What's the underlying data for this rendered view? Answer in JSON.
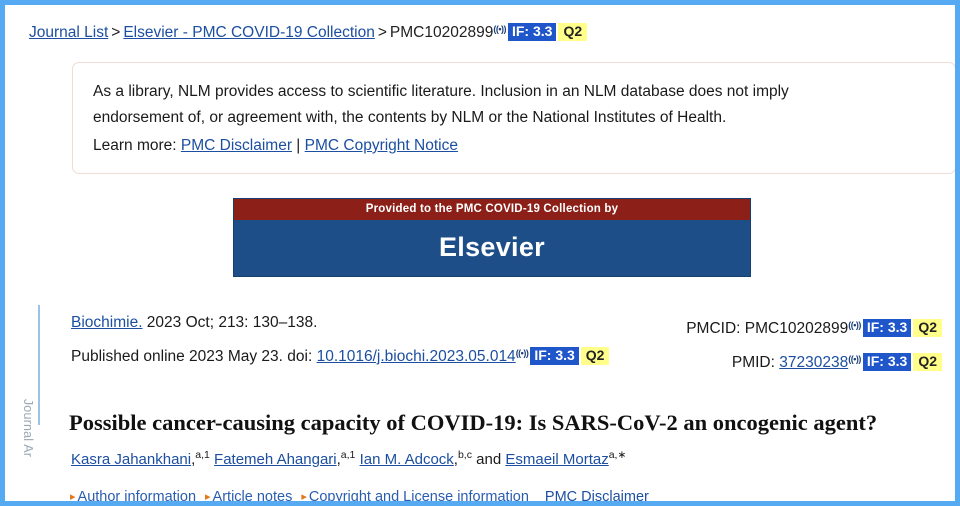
{
  "breadcrumb": {
    "journal_list": "Journal List",
    "separator": ">",
    "collection": "Elsevier - PMC COVID-19 Collection",
    "article_id": "PMC10202899",
    "signal_icon": "((•))",
    "impact_factor_badge": "IF: 3.3",
    "quartile_badge": "Q2"
  },
  "left_rail": {
    "label": "Journal Ar"
  },
  "disclaimer": {
    "line1": "As a library, NLM provides access to scientific literature. Inclusion in an NLM database does not imply",
    "line2": "endorsement of, or agreement with, the contents by NLM or the National Institutes of Health.",
    "learn_more_label": "Learn more:",
    "link_disclaimer": "PMC Disclaimer",
    "pipe": "|",
    "link_copyright": "PMC Copyright Notice"
  },
  "banner": {
    "provided_text": "Provided to the PMC COVID-19 Collection by",
    "publisher": "Elsevier",
    "header_color": "#8c2018",
    "body_color": "#1d4e87"
  },
  "citation": {
    "journal": "Biochimie.",
    "issue_text": " 2023 Oct; 213: 130–138.",
    "published_prefix": "Published online 2023 May 23. doi: ",
    "doi": "10.1016/j.biochi.2023.05.014",
    "signal_icon": "((•))",
    "impact_factor_badge": "IF: 3.3",
    "quartile_badge": "Q2"
  },
  "ids": {
    "pmcid_label": "PMCID: ",
    "pmcid_value": "PMC10202899",
    "pmid_label": "PMID: ",
    "pmid_value": "37230238",
    "signal_icon": "((•))",
    "impact_factor_badge": "IF: 3.3",
    "quartile_badge": "Q2"
  },
  "article": {
    "title": "Possible cancer-causing capacity of COVID-19: Is SARS-CoV-2 an oncogenic agent?",
    "authors": [
      {
        "name": "Kasra Jahankhani",
        "sup": "a,1",
        "trailing": " "
      },
      {
        "name": "Fatemeh Ahangari",
        "sup": "a,1",
        "trailing": " "
      },
      {
        "name": "Ian M. Adcock",
        "sup": "b,c",
        "trailing": " and "
      },
      {
        "name": "Esmaeil Mortaz",
        "sup": "a,∗",
        "trailing": ""
      }
    ],
    "comma": ","
  },
  "footer": {
    "marker": "▸",
    "author_information": "Author information",
    "article_notes": "Article notes",
    "copyright_license": "Copyright and License information",
    "pmc_disclaimer": "PMC Disclaimer"
  },
  "colors": {
    "frame": "#55aaf2",
    "link": "#1c4fa1",
    "badge_if_bg": "#1f56c9",
    "badge_q_bg": "#ffff8a",
    "marker": "#e2761b"
  }
}
